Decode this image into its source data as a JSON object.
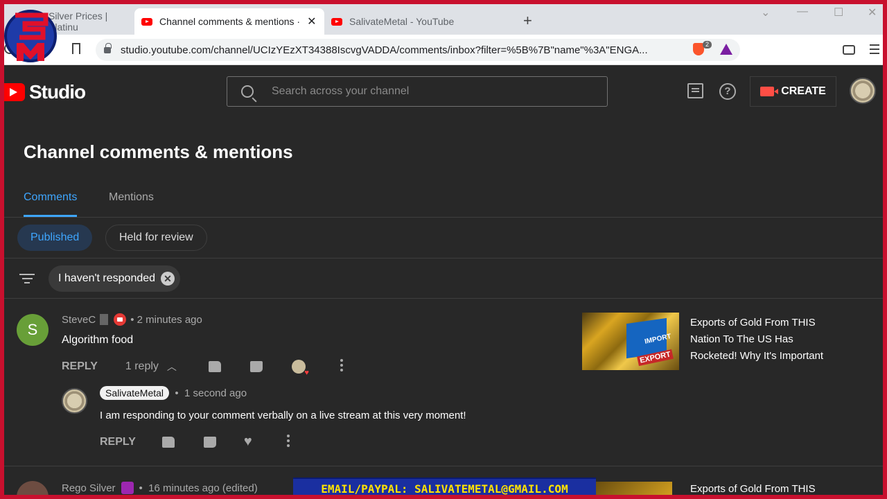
{
  "browser": {
    "tabs": [
      {
        "label": "Silver Prices | Platinu"
      },
      {
        "label": "Channel comments & mentions ·"
      },
      {
        "label": "SalivateMetal - YouTube"
      }
    ],
    "url": "studio.youtube.com/channel/UCIzYEzXT34388IscvgVADDA/comments/inbox?filter=%5B%7B\"name\"%3A\"ENGA...",
    "brave_count": "2"
  },
  "header": {
    "logo": "Studio",
    "search_placeholder": "Search across your channel",
    "create_label": "CREATE"
  },
  "page": {
    "title": "Channel comments & mentions",
    "tabs": [
      "Comments",
      "Mentions"
    ],
    "chips": [
      "Published",
      "Held for review"
    ],
    "filter": "I haven't responded"
  },
  "comments": [
    {
      "avatar_letter": "S",
      "author": "SteveC",
      "time": "2 minutes ago",
      "text": "Algorithm food",
      "reply_label": "REPLY",
      "replies_count": "1 reply",
      "video_title": "Exports of Gold From THIS Nation To The US Has Rocketed! Why It's Important",
      "thumb_text_1": "IMPORT",
      "thumb_text_2": "EXPORT",
      "reply": {
        "author": "SalivateMetal",
        "time": "1 second ago",
        "text": "I am responding to your comment verbally on a live stream at this very moment!",
        "reply_label": "REPLY"
      }
    },
    {
      "author": "Rego Silver",
      "time": "16 minutes ago (edited)",
      "video_title": "Exports of Gold From THIS"
    }
  ],
  "overlay": {
    "email": "EMAIL/PAYPAL: SALIVATEMETAL@GMAIL.COM",
    "logo_text": "SM"
  }
}
